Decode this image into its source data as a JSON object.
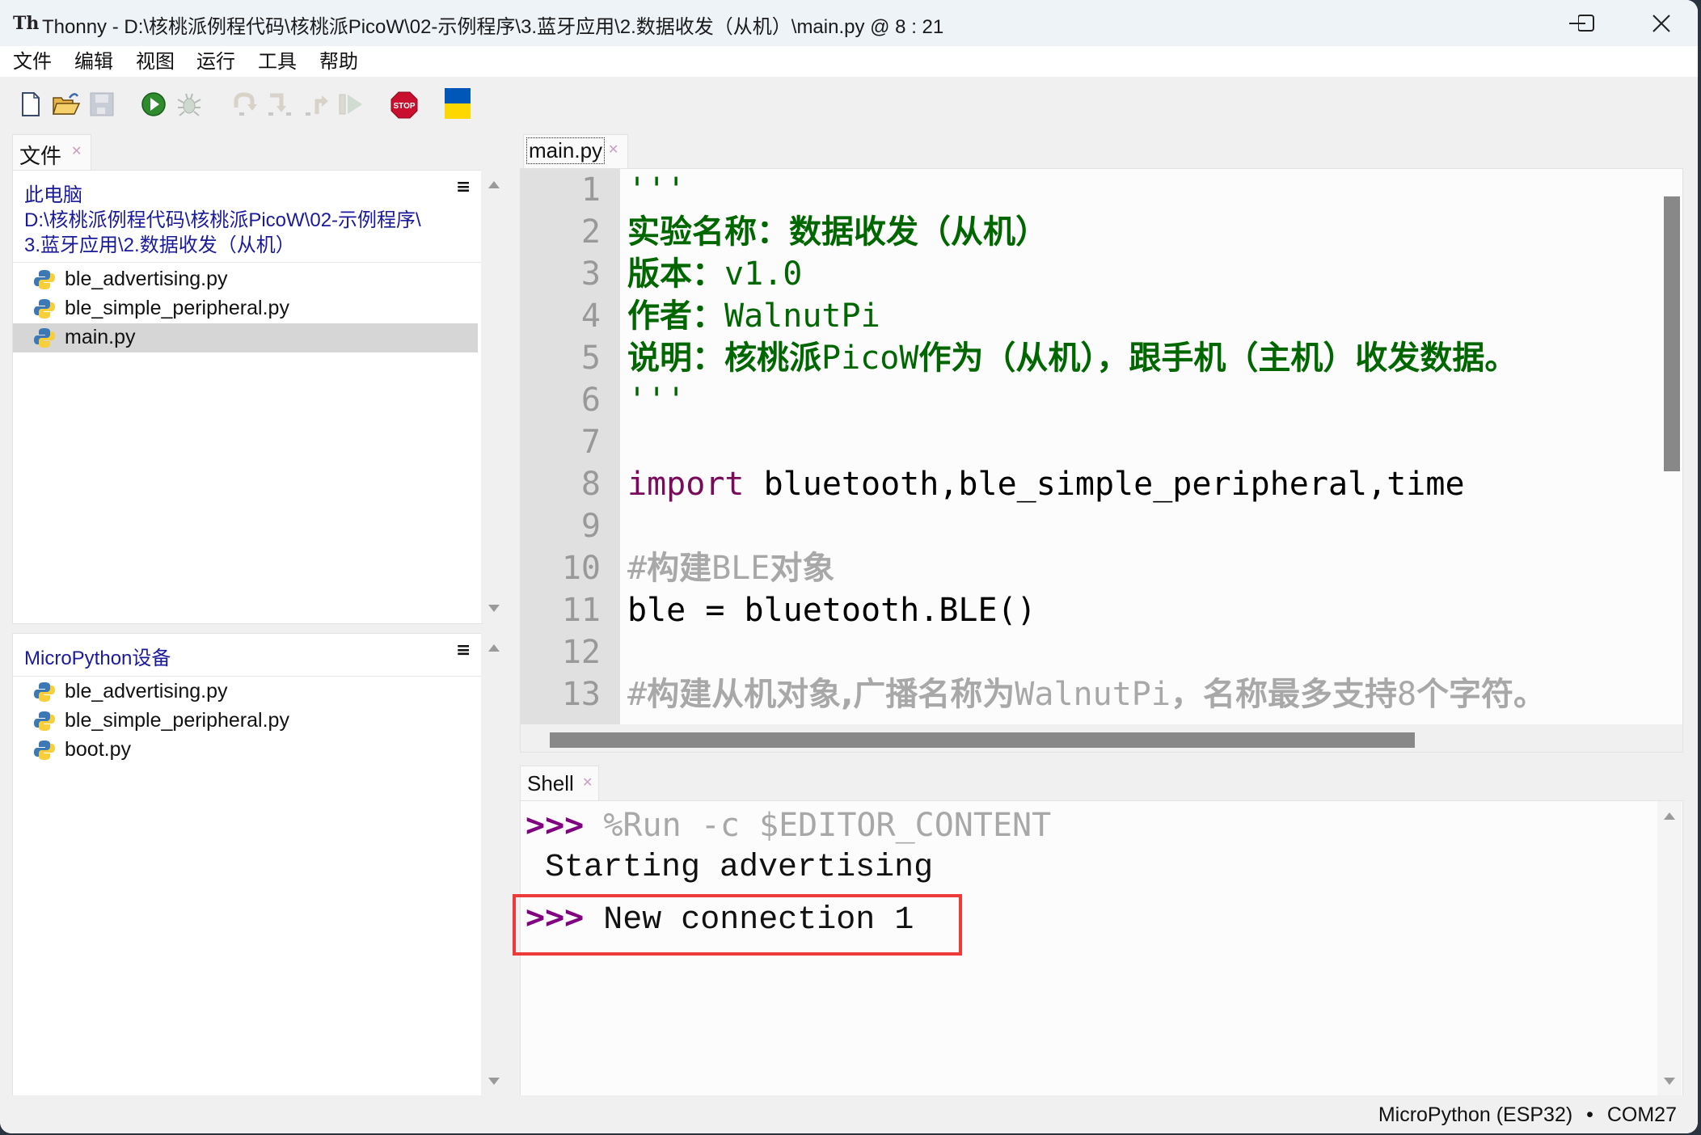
{
  "window": {
    "app_icon": "thonny-icon",
    "title": "Thonny  -  D:\\核桃派例程代码\\核桃派PicoW\\02-示例程序\\3.蓝牙应用\\2.数据收发（从机）\\main.py  @  8 : 21",
    "controls": [
      "minimize-icon",
      "maximize-icon",
      "close-icon"
    ]
  },
  "menubar": {
    "items": [
      "文件",
      "编辑",
      "视图",
      "运行",
      "工具",
      "帮助"
    ]
  },
  "toolbar": {
    "buttons": [
      {
        "name": "new-file-icon",
        "enabled": true
      },
      {
        "name": "open-file-icon",
        "enabled": true
      },
      {
        "name": "save-file-icon",
        "enabled": false
      },
      {
        "name": "run-icon",
        "enabled": true
      },
      {
        "name": "debug-icon",
        "enabled": false
      },
      {
        "name": "step-over-icon",
        "enabled": false
      },
      {
        "name": "step-into-icon",
        "enabled": false
      },
      {
        "name": "step-out-icon",
        "enabled": false
      },
      {
        "name": "resume-icon",
        "enabled": false
      },
      {
        "name": "stop-icon",
        "enabled": true,
        "label": "STOP"
      },
      {
        "name": "ukraine-flag-icon",
        "enabled": true
      }
    ],
    "colors": {
      "run": "#2e8b2e",
      "stop": "#c8102e",
      "flag_top": "#0057b7",
      "flag_bottom": "#ffd700"
    }
  },
  "files_pane": {
    "tab_label": "文件",
    "local": {
      "header": "此电脑",
      "path_lines": [
        "D:\\核桃派例程代码\\核桃派PicoW\\02-示例程序\\",
        "3.蓝牙应用\\2.数据收发（从机）"
      ],
      "files": [
        {
          "name": "ble_advertising.py",
          "selected": false
        },
        {
          "name": "ble_simple_peripheral.py",
          "selected": false
        },
        {
          "name": "main.py",
          "selected": true
        }
      ]
    },
    "device": {
      "header": "MicroPython设备",
      "files": [
        {
          "name": "ble_advertising.py"
        },
        {
          "name": "ble_simple_peripheral.py"
        },
        {
          "name": "boot.py"
        }
      ]
    },
    "menu_icon": "≡"
  },
  "editor": {
    "tab_label": "main.py",
    "lines": [
      {
        "n": "1",
        "parts": [
          {
            "t": "'''",
            "c": "str"
          }
        ]
      },
      {
        "n": "2",
        "parts": [
          {
            "t": "实验名称：数据收发（从机）",
            "c": "strb"
          }
        ]
      },
      {
        "n": "3",
        "parts": [
          {
            "t": "版本：",
            "c": "strb"
          },
          {
            "t": "v1.0",
            "c": "str"
          }
        ]
      },
      {
        "n": "4",
        "parts": [
          {
            "t": "作者：",
            "c": "strb"
          },
          {
            "t": "WalnutPi",
            "c": "str"
          }
        ]
      },
      {
        "n": "5",
        "parts": [
          {
            "t": "说明：核桃派",
            "c": "strb"
          },
          {
            "t": "PicoW",
            "c": "str"
          },
          {
            "t": "作为（从机），跟手机（主机）收发数据。",
            "c": "strb"
          }
        ]
      },
      {
        "n": "6",
        "parts": [
          {
            "t": "'''",
            "c": "str"
          }
        ]
      },
      {
        "n": "7",
        "parts": []
      },
      {
        "n": "8",
        "parts": [
          {
            "t": "import",
            "c": "kw"
          },
          {
            "t": " bluetooth,ble_simple_peripheral,time",
            "c": ""
          }
        ]
      },
      {
        "n": "9",
        "parts": []
      },
      {
        "n": "10",
        "parts": [
          {
            "t": "#",
            "c": "cm"
          },
          {
            "t": "构建",
            "c": "cmb"
          },
          {
            "t": "BLE",
            "c": "cm"
          },
          {
            "t": "对象",
            "c": "cmb"
          }
        ]
      },
      {
        "n": "11",
        "parts": [
          {
            "t": "ble = bluetooth.BLE()",
            "c": ""
          }
        ]
      },
      {
        "n": "12",
        "parts": []
      },
      {
        "n": "13",
        "parts": [
          {
            "t": "#",
            "c": "cm"
          },
          {
            "t": "构建从机对象,广播名称为",
            "c": "cmb"
          },
          {
            "t": "WalnutPi",
            "c": "cm"
          },
          {
            "t": "，名称最多支持",
            "c": "cmb"
          },
          {
            "t": "8",
            "c": "cm"
          },
          {
            "t": "个字符。",
            "c": "cmb"
          }
        ]
      }
    ],
    "colors": {
      "string": "#006600",
      "keyword": "#7a0a5a",
      "comment": "#a8a8a8",
      "gutter": "#e0e0e0"
    }
  },
  "shell": {
    "tab_label": "Shell",
    "lines": [
      {
        "prompt": ">>>",
        "text": " %Run -c $EDITOR_CONTENT",
        "style": "gray"
      },
      {
        "prompt": "",
        "text": " Starting advertising",
        "style": "normal"
      },
      {
        "prompt": ">>>",
        "text": " New connection 1",
        "style": "normal",
        "highlighted": true
      }
    ],
    "highlight_color": "#ef3a3a"
  },
  "statusbar": {
    "interpreter": "MicroPython (ESP32)",
    "separator": "•",
    "port": "COM27"
  }
}
